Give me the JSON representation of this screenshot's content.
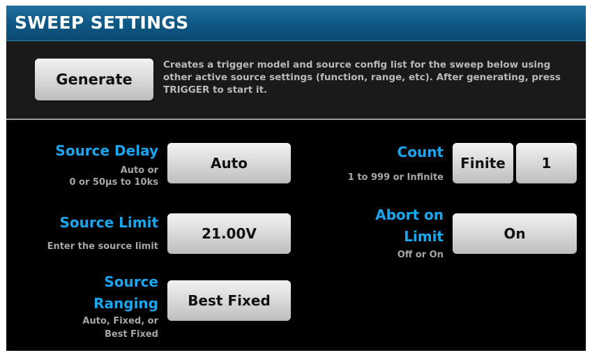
{
  "title": "SWEEP SETTINGS",
  "generate": {
    "button_label": "Generate",
    "description": "Creates a trigger model and source config list for the sweep below using other active source settings (function, range, etc). After generating, press TRIGGER to start it."
  },
  "settings": {
    "source_delay": {
      "label": "Source Delay",
      "hint_1": "Auto or",
      "hint_2": "0 or 50µs to 10ks",
      "value": "Auto"
    },
    "source_limit": {
      "label": "Source Limit",
      "hint": "Enter the source limit",
      "value": "21.00V"
    },
    "source_ranging": {
      "label_1": "Source",
      "label_2": "Ranging",
      "hint_1": "Auto, Fixed, or",
      "hint_2": "Best Fixed",
      "value": "Best Fixed"
    },
    "count": {
      "label": "Count",
      "hint": "1 to 999 or Infinite",
      "mode": "Finite",
      "value": "1"
    },
    "abort_on_limit": {
      "label_1": "Abort on",
      "label_2": "Limit",
      "hint": "Off or On",
      "value": "On"
    }
  },
  "colors": {
    "label": "#1aa6ef",
    "title_bar": "#0e5784",
    "background": "#000000",
    "panel": "#1a1a1a",
    "button": "#d6d6d6",
    "hint": "#a6a6a6"
  }
}
